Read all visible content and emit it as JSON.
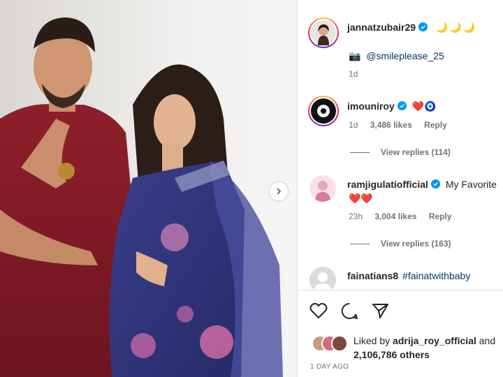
{
  "post": {
    "author": "jannatzubair29",
    "caption_emoji": "🌙🌙🌙",
    "caption_camera": "📷",
    "caption_mention": "@smileplease_25",
    "caption_age": "1d"
  },
  "comments": [
    {
      "user": "imouniroy",
      "verified": true,
      "text": "❤️🧿",
      "age": "1d",
      "likes": "3,486 likes",
      "reply": "Reply",
      "view_replies": "View replies (114)"
    },
    {
      "user": "ramjigulatiofficial",
      "verified": true,
      "text": "My Favorite",
      "text2": "❤️❤️",
      "age": "23h",
      "likes": "3,004 likes",
      "reply": "Reply",
      "view_replies": "View replies (163)"
    },
    {
      "user": "fainatians8",
      "text": "#fainatwithbaby"
    }
  ],
  "footer": {
    "liked_by_prefix": "Liked by ",
    "liked_by_user": "adrija_roy_official",
    "liked_by_and": " and",
    "others": "2,106,786 others",
    "date": "1 DAY AGO"
  },
  "icons": {
    "like": "heart-icon",
    "comment": "comment-icon",
    "share": "share-icon",
    "next": "chevron-right-icon",
    "verified": "verified-badge-icon"
  },
  "colors": {
    "verified": "#0095f6",
    "hashtag": "#00376b",
    "secondary_text": "#737373",
    "heart_red": "#e0245e"
  }
}
